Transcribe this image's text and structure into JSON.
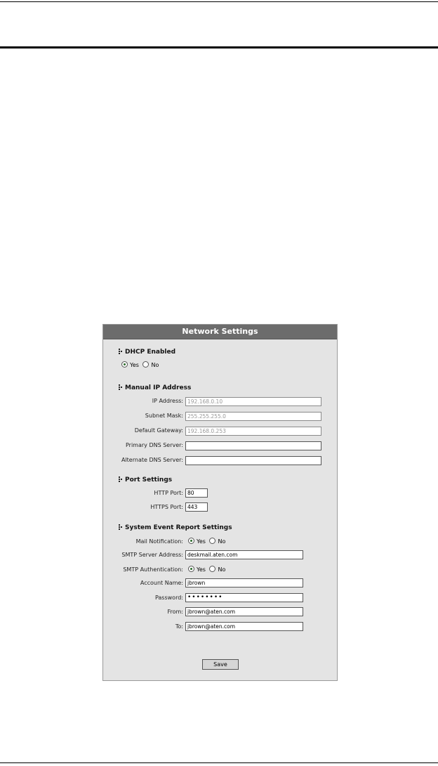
{
  "panel": {
    "title": "Network Settings"
  },
  "dhcp": {
    "heading": "DHCP Enabled",
    "yes_label": "Yes",
    "no_label": "No",
    "selected": "Yes"
  },
  "manual_ip": {
    "heading": "Manual IP Address",
    "ip_label": "IP Address:",
    "ip_value": "192.168.0.10",
    "mask_label": "Subnet Mask:",
    "mask_value": "255.255.255.0",
    "gateway_label": "Default Gateway:",
    "gateway_value": "192.168.0.253",
    "primary_dns_label": "Primary DNS Server:",
    "primary_dns_value": "",
    "alternate_dns_label": "Alternate DNS Server:",
    "alternate_dns_value": ""
  },
  "ports": {
    "heading": "Port Settings",
    "http_label": "HTTP Port:",
    "http_value": "80",
    "https_label": "HTTPS Port:",
    "https_value": "443"
  },
  "report": {
    "heading": "System Event Report Settings",
    "mail_label": "Mail Notification:",
    "mail_yes": "Yes",
    "mail_no": "No",
    "smtp_server_label": "SMTP Server Address:",
    "smtp_server_value": "deskmail.aten.com",
    "smtp_auth_label": "SMTP Authentication:",
    "auth_yes": "Yes",
    "auth_no": "No",
    "account_label": "Account Name:",
    "account_value": "jbrown",
    "password_label": "Password:",
    "password_value": "••••••••",
    "from_label": "From:",
    "from_value": "jbrown@aten.com",
    "to_label": "To:",
    "to_value": "jbrown@aten.com"
  },
  "actions": {
    "save_label": "Save"
  }
}
